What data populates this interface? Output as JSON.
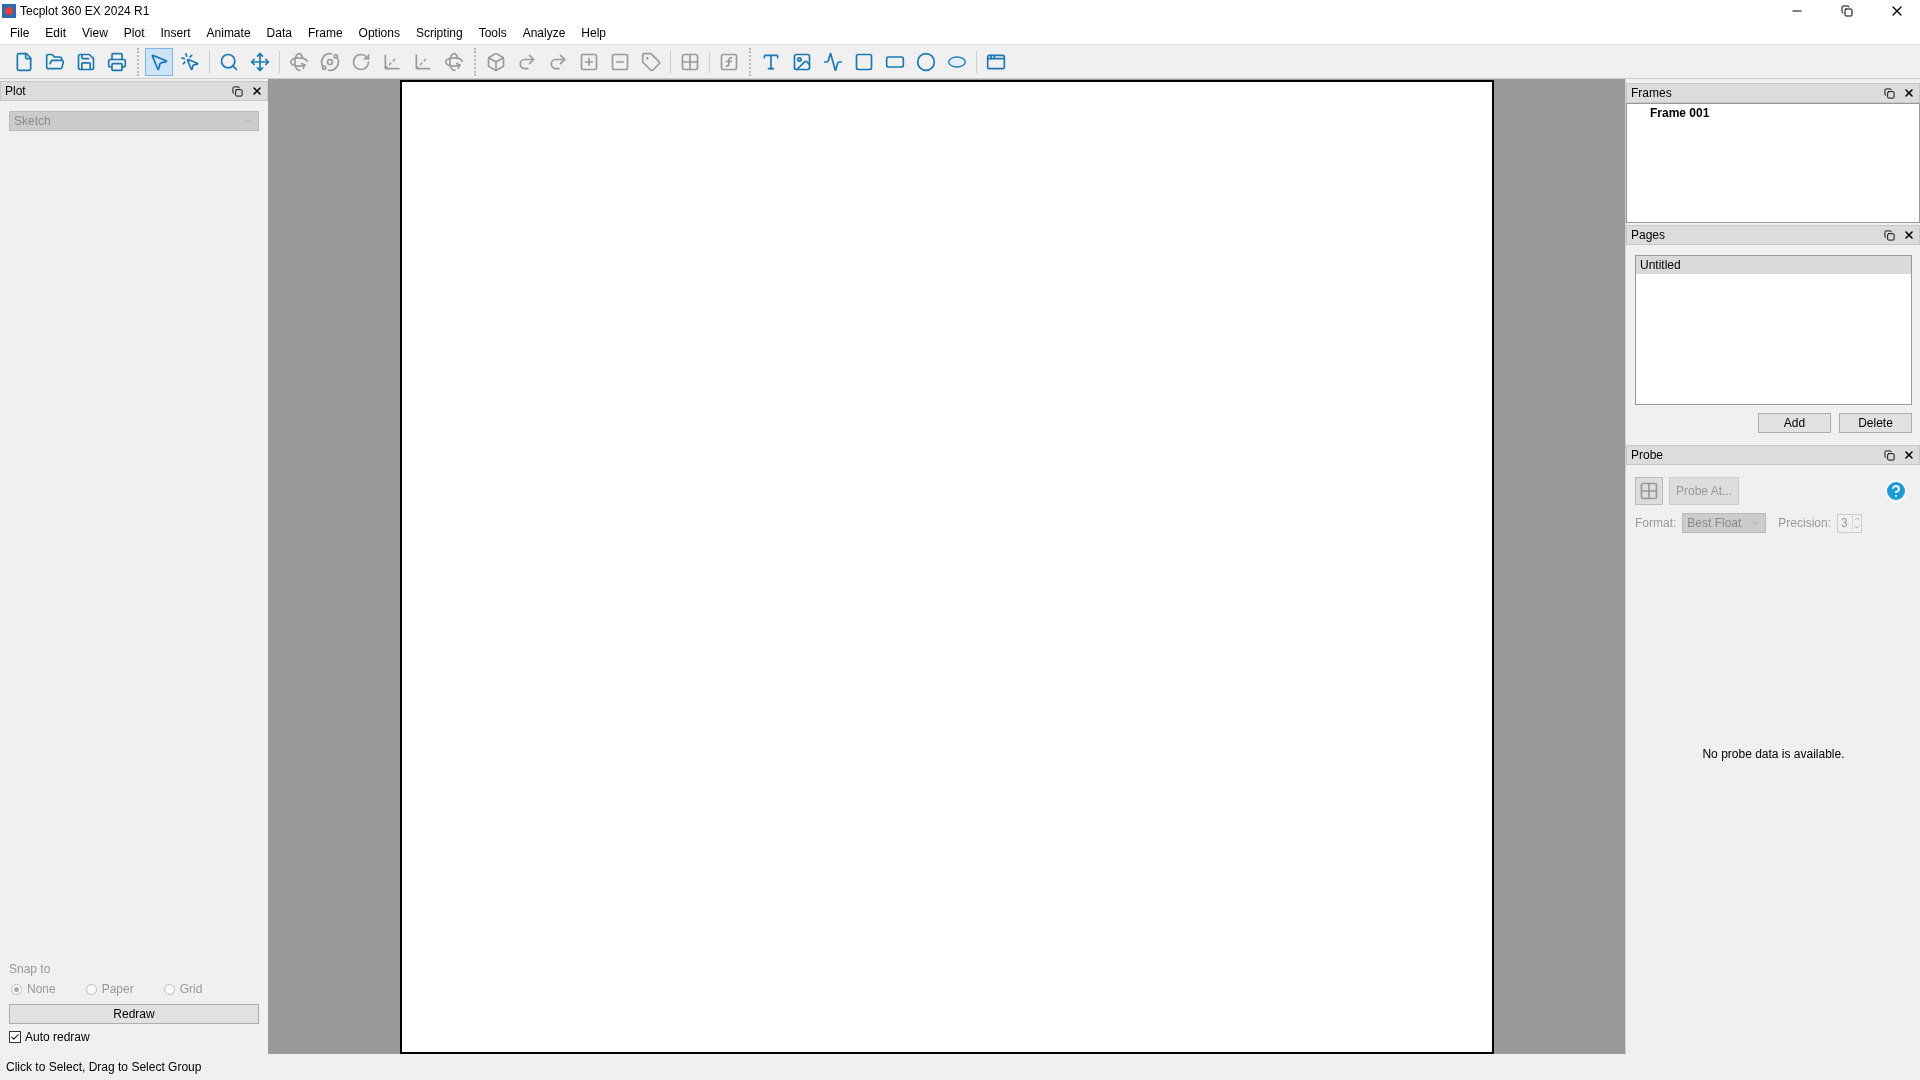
{
  "window": {
    "title": "Tecplot 360 EX 2024 R1"
  },
  "menu": [
    "File",
    "Edit",
    "View",
    "Plot",
    "Insert",
    "Animate",
    "Data",
    "Frame",
    "Options",
    "Scripting",
    "Tools",
    "Analyze",
    "Help"
  ],
  "toolbar": [
    [
      [
        {
          "kind": "new",
          "selected": false,
          "disabled": false
        },
        {
          "kind": "open",
          "selected": false,
          "disabled": false
        },
        {
          "kind": "save",
          "selected": false,
          "disabled": false
        },
        {
          "kind": "print",
          "selected": false,
          "disabled": false
        }
      ]
    ],
    [
      [
        {
          "kind": "select",
          "selected": true,
          "disabled": false
        },
        {
          "kind": "adjust",
          "selected": false,
          "disabled": false
        }
      ],
      [
        {
          "kind": "zoom",
          "selected": false,
          "disabled": false
        },
        {
          "kind": "translate",
          "selected": false,
          "disabled": false
        }
      ],
      [
        {
          "kind": "spin",
          "selected": false,
          "disabled": true
        },
        {
          "kind": "rollerball",
          "selected": false,
          "disabled": true
        },
        {
          "kind": "rotate",
          "selected": false,
          "disabled": true
        },
        {
          "kind": "xrotate",
          "selected": false,
          "disabled": true
        },
        {
          "kind": "yrotate",
          "selected": false,
          "disabled": true
        },
        {
          "kind": "zrotate",
          "selected": false,
          "disabled": true
        }
      ]
    ],
    [
      [
        {
          "kind": "box",
          "selected": false,
          "disabled": true
        },
        {
          "kind": "curve",
          "selected": false,
          "disabled": true
        },
        {
          "kind": "curve",
          "selected": false,
          "disabled": true
        },
        {
          "kind": "addslice",
          "selected": false,
          "disabled": true
        },
        {
          "kind": "removeslice",
          "selected": false,
          "disabled": true
        },
        {
          "kind": "label",
          "selected": false,
          "disabled": true
        }
      ],
      [
        {
          "kind": "grid",
          "selected": false,
          "disabled": true
        }
      ],
      [
        {
          "kind": "function",
          "selected": false,
          "disabled": true
        }
      ]
    ],
    [
      [
        {
          "kind": "text",
          "selected": false,
          "disabled": false
        },
        {
          "kind": "image",
          "selected": false,
          "disabled": false
        },
        {
          "kind": "polyline",
          "selected": false,
          "disabled": false
        },
        {
          "kind": "square",
          "selected": false,
          "disabled": false
        },
        {
          "kind": "rectangle",
          "selected": false,
          "disabled": false
        },
        {
          "kind": "circle",
          "selected": false,
          "disabled": false
        },
        {
          "kind": "ellipse",
          "selected": false,
          "disabled": false
        }
      ],
      [
        {
          "kind": "frame",
          "selected": false,
          "disabled": false
        }
      ]
    ]
  ],
  "plot_panel": {
    "title": "Plot",
    "plot_type": {
      "value": "Sketch",
      "disabled": true
    },
    "snap_label": "Snap to",
    "snap_disabled": true,
    "snap_options": [
      {
        "label": "None",
        "selected": true
      },
      {
        "label": "Paper",
        "selected": false
      },
      {
        "label": "Grid",
        "selected": false
      }
    ],
    "redraw_button": "Redraw",
    "auto_redraw": {
      "label": "Auto redraw",
      "checked": true
    }
  },
  "frames_panel": {
    "title": "Frames",
    "items": [
      {
        "label": "Frame 001",
        "active": true
      }
    ]
  },
  "pages_panel": {
    "title": "Pages",
    "items": [
      {
        "label": "Untitled",
        "selected": true
      }
    ],
    "buttons": [
      "Add",
      "Delete"
    ]
  },
  "probe_panel": {
    "title": "Probe",
    "probe_button": {
      "label": "Probe At...",
      "disabled": true
    },
    "format_label": "Format:",
    "format": {
      "value": "Best Float",
      "disabled": true
    },
    "precision_label": "Precision:",
    "precision": {
      "value": "3",
      "disabled": true
    },
    "message": "No probe data is available."
  },
  "status_bar": "Click to Select, Drag to Select Group"
}
